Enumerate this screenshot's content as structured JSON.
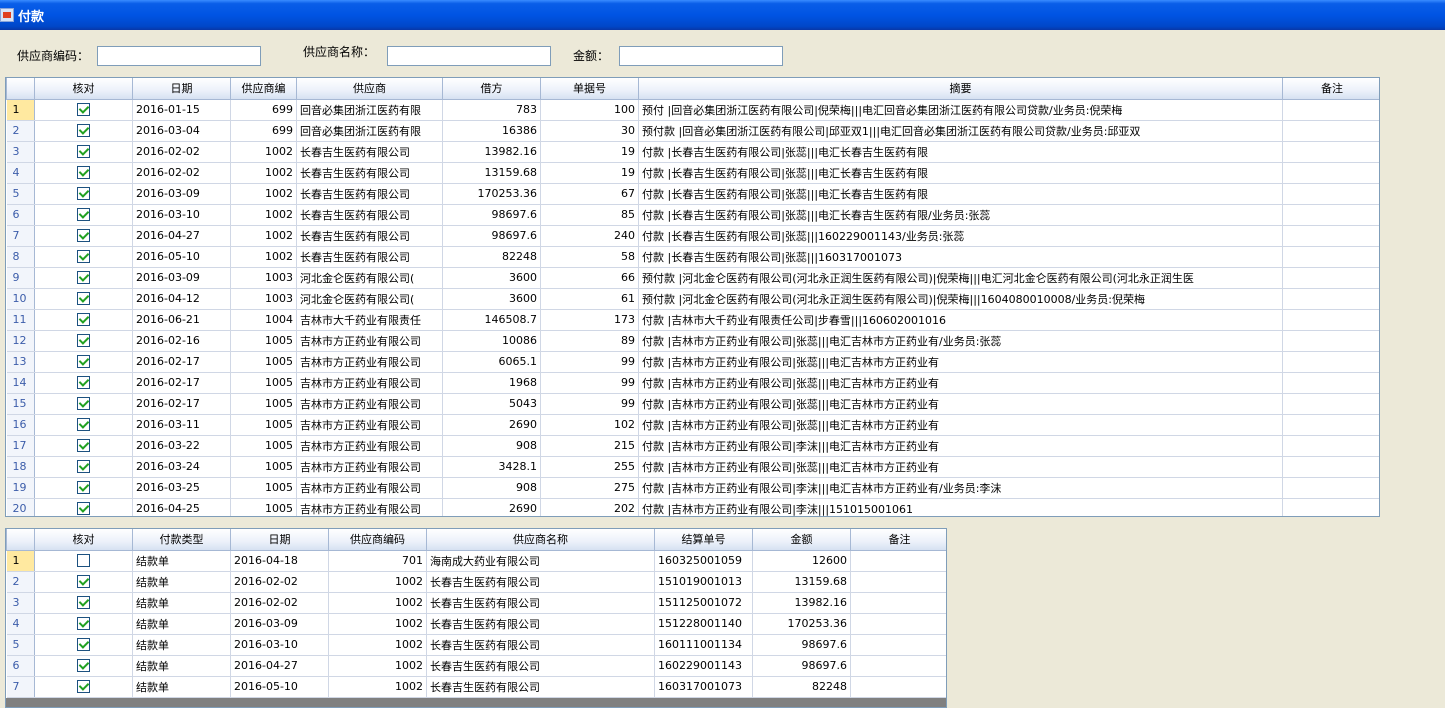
{
  "window": {
    "title": "付款"
  },
  "filters": {
    "supplier_code_label": "供应商编码：",
    "supplier_name_label": "供应商名称：",
    "amount_label": "金额：",
    "supplier_code_value": "",
    "supplier_name_value": "",
    "amount_value": ""
  },
  "top_grid": {
    "columns": [
      "核对",
      "日期",
      "供应商编",
      "供应商",
      "借方",
      "单据号",
      "摘要",
      "备注"
    ],
    "rows": [
      {
        "n": "1",
        "checked": true,
        "date": "2016-01-15",
        "code": "699",
        "supplier": "回音必集团浙江医药有限",
        "debit": "783",
        "doc": "100",
        "summary": "预付 |回音必集团浙江医药有限公司|倪荣梅|||电汇回音必集团浙江医药有限公司贷款/业务员:倪荣梅",
        "note": ""
      },
      {
        "n": "2",
        "checked": true,
        "date": "2016-03-04",
        "code": "699",
        "supplier": "回音必集团浙江医药有限",
        "debit": "16386",
        "doc": "30",
        "summary": "预付款 |回音必集团浙江医药有限公司|邱亚双1|||电汇回音必集团浙江医药有限公司贷款/业务员:邱亚双",
        "note": ""
      },
      {
        "n": "3",
        "checked": true,
        "date": "2016-02-02",
        "code": "1002",
        "supplier": "长春吉生医药有限公司",
        "debit": "13982.16",
        "doc": "19",
        "summary": "付款 |长春吉生医药有限公司|张蕊|||电汇长春吉生医药有限",
        "note": ""
      },
      {
        "n": "4",
        "checked": true,
        "date": "2016-02-02",
        "code": "1002",
        "supplier": "长春吉生医药有限公司",
        "debit": "13159.68",
        "doc": "19",
        "summary": "付款 |长春吉生医药有限公司|张蕊|||电汇长春吉生医药有限",
        "note": ""
      },
      {
        "n": "5",
        "checked": true,
        "date": "2016-03-09",
        "code": "1002",
        "supplier": "长春吉生医药有限公司",
        "debit": "170253.36",
        "doc": "67",
        "summary": "付款 |长春吉生医药有限公司|张蕊|||电汇长春吉生医药有限",
        "note": ""
      },
      {
        "n": "6",
        "checked": true,
        "date": "2016-03-10",
        "code": "1002",
        "supplier": "长春吉生医药有限公司",
        "debit": "98697.6",
        "doc": "85",
        "summary": "付款 |长春吉生医药有限公司|张蕊|||电汇长春吉生医药有限/业务员:张蕊",
        "note": ""
      },
      {
        "n": "7",
        "checked": true,
        "date": "2016-04-27",
        "code": "1002",
        "supplier": "长春吉生医药有限公司",
        "debit": "98697.6",
        "doc": "240",
        "summary": "付款 |长春吉生医药有限公司|张蕊|||160229001143/业务员:张蕊",
        "note": ""
      },
      {
        "n": "8",
        "checked": true,
        "date": "2016-05-10",
        "code": "1002",
        "supplier": "长春吉生医药有限公司",
        "debit": "82248",
        "doc": "58",
        "summary": "付款 |长春吉生医药有限公司|张蕊|||160317001073",
        "note": ""
      },
      {
        "n": "9",
        "checked": true,
        "date": "2016-03-09",
        "code": "1003",
        "supplier": "河北金仑医药有限公司(",
        "debit": "3600",
        "doc": "66",
        "summary": "预付款 |河北金仑医药有限公司(河北永正润生医药有限公司)|倪荣梅|||电汇河北金仑医药有限公司(河北永正润生医",
        "note": ""
      },
      {
        "n": "10",
        "checked": true,
        "date": "2016-04-12",
        "code": "1003",
        "supplier": "河北金仑医药有限公司(",
        "debit": "3600",
        "doc": "61",
        "summary": "预付款 |河北金仑医药有限公司(河北永正润生医药有限公司)|倪荣梅|||1604080010008/业务员:倪荣梅",
        "note": ""
      },
      {
        "n": "11",
        "checked": true,
        "date": "2016-06-21",
        "code": "1004",
        "supplier": "吉林市大千药业有限责任",
        "debit": "146508.7",
        "doc": "173",
        "summary": "付款 |吉林市大千药业有限责任公司|步春雪|||160602001016",
        "note": ""
      },
      {
        "n": "12",
        "checked": true,
        "date": "2016-02-16",
        "code": "1005",
        "supplier": "吉林市方正药业有限公司",
        "debit": "10086",
        "doc": "89",
        "summary": "付款 |吉林市方正药业有限公司|张蕊|||电汇吉林市方正药业有/业务员:张蕊",
        "note": ""
      },
      {
        "n": "13",
        "checked": true,
        "date": "2016-02-17",
        "code": "1005",
        "supplier": "吉林市方正药业有限公司",
        "debit": "6065.1",
        "doc": "99",
        "summary": "付款 |吉林市方正药业有限公司|张蕊|||电汇吉林市方正药业有",
        "note": ""
      },
      {
        "n": "14",
        "checked": true,
        "date": "2016-02-17",
        "code": "1005",
        "supplier": "吉林市方正药业有限公司",
        "debit": "1968",
        "doc": "99",
        "summary": "付款 |吉林市方正药业有限公司|张蕊|||电汇吉林市方正药业有",
        "note": ""
      },
      {
        "n": "15",
        "checked": true,
        "date": "2016-02-17",
        "code": "1005",
        "supplier": "吉林市方正药业有限公司",
        "debit": "5043",
        "doc": "99",
        "summary": "付款 |吉林市方正药业有限公司|张蕊|||电汇吉林市方正药业有",
        "note": ""
      },
      {
        "n": "16",
        "checked": true,
        "date": "2016-03-11",
        "code": "1005",
        "supplier": "吉林市方正药业有限公司",
        "debit": "2690",
        "doc": "102",
        "summary": "付款 |吉林市方正药业有限公司|张蕊|||电汇吉林市方正药业有",
        "note": ""
      },
      {
        "n": "17",
        "checked": true,
        "date": "2016-03-22",
        "code": "1005",
        "supplier": "吉林市方正药业有限公司",
        "debit": "908",
        "doc": "215",
        "summary": "付款 |吉林市方正药业有限公司|李沫|||电汇吉林市方正药业有",
        "note": ""
      },
      {
        "n": "18",
        "checked": true,
        "date": "2016-03-24",
        "code": "1005",
        "supplier": "吉林市方正药业有限公司",
        "debit": "3428.1",
        "doc": "255",
        "summary": "付款 |吉林市方正药业有限公司|张蕊|||电汇吉林市方正药业有",
        "note": ""
      },
      {
        "n": "19",
        "checked": true,
        "date": "2016-03-25",
        "code": "1005",
        "supplier": "吉林市方正药业有限公司",
        "debit": "908",
        "doc": "275",
        "summary": "付款 |吉林市方正药业有限公司|李沫|||电汇吉林市方正药业有/业务员:李沫",
        "note": ""
      },
      {
        "n": "20",
        "checked": true,
        "date": "2016-04-25",
        "code": "1005",
        "supplier": "吉林市方正药业有限公司",
        "debit": "2690",
        "doc": "202",
        "summary": "付款 |吉林市方正药业有限公司|李沫|||151015001061",
        "note": ""
      }
    ]
  },
  "bottom_grid": {
    "columns": [
      "核对",
      "付款类型",
      "日期",
      "供应商编码",
      "供应商名称",
      "结算单号",
      "金额",
      "备注"
    ],
    "rows": [
      {
        "n": "1",
        "checked": false,
        "type": "结款单",
        "date": "2016-04-18",
        "code": "701",
        "name": "海南成大药业有限公司",
        "settle": "160325001059",
        "amount": "12600",
        "note": ""
      },
      {
        "n": "2",
        "checked": true,
        "type": "结款单",
        "date": "2016-02-02",
        "code": "1002",
        "name": "长春吉生医药有限公司",
        "settle": "151019001013",
        "amount": "13159.68",
        "note": ""
      },
      {
        "n": "3",
        "checked": true,
        "type": "结款单",
        "date": "2016-02-02",
        "code": "1002",
        "name": "长春吉生医药有限公司",
        "settle": "151125001072",
        "amount": "13982.16",
        "note": ""
      },
      {
        "n": "4",
        "checked": true,
        "type": "结款单",
        "date": "2016-03-09",
        "code": "1002",
        "name": "长春吉生医药有限公司",
        "settle": "151228001140",
        "amount": "170253.36",
        "note": ""
      },
      {
        "n": "5",
        "checked": true,
        "type": "结款单",
        "date": "2016-03-10",
        "code": "1002",
        "name": "长春吉生医药有限公司",
        "settle": "160111001134",
        "amount": "98697.6",
        "note": ""
      },
      {
        "n": "6",
        "checked": true,
        "type": "结款单",
        "date": "2016-04-27",
        "code": "1002",
        "name": "长春吉生医药有限公司",
        "settle": "160229001143",
        "amount": "98697.6",
        "note": ""
      },
      {
        "n": "7",
        "checked": true,
        "type": "结款单",
        "date": "2016-05-10",
        "code": "1002",
        "name": "长春吉生医药有限公司",
        "settle": "160317001073",
        "amount": "82248",
        "note": ""
      }
    ]
  }
}
